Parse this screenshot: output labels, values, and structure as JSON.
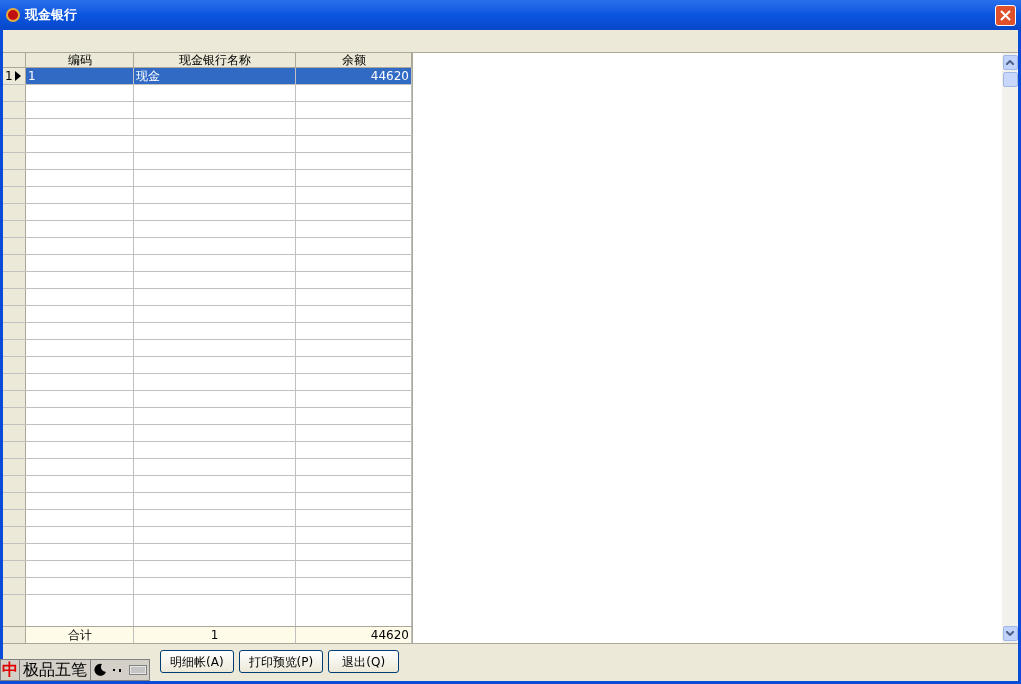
{
  "window": {
    "title": "现金银行"
  },
  "table": {
    "columns": [
      "编码",
      "现金银行名称",
      "余额"
    ],
    "rows": [
      {
        "row_number": "1",
        "cells": [
          "1",
          "现金",
          "44620"
        ],
        "selected": true
      }
    ],
    "footer": [
      "合计",
      "1",
      "44620"
    ]
  },
  "buttons": [
    "明细帐(A)",
    "打印预览(P)",
    "退出(Q)"
  ],
  "ime_bar": {
    "mode": "中",
    "name": "极品五笔"
  }
}
